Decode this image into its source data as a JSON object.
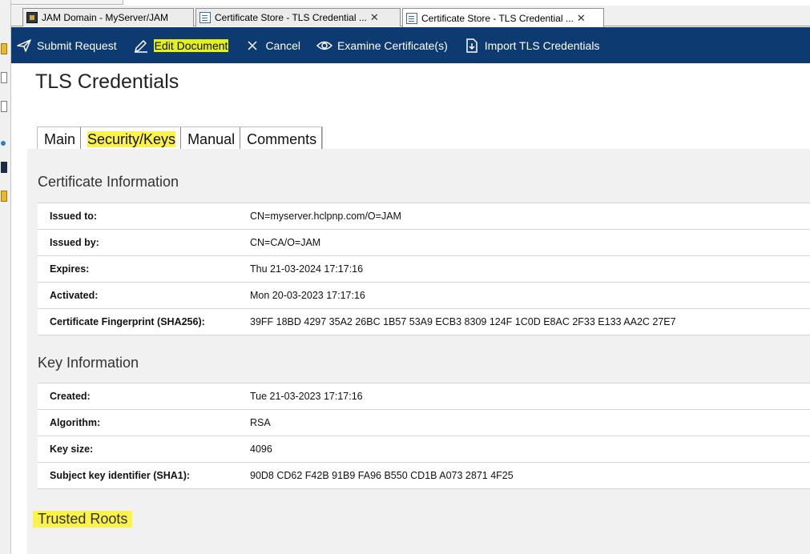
{
  "tabs": [
    {
      "label": "JAM Domain - MyServer/JAM",
      "icon": "domain-icon",
      "active": false,
      "closable": false
    },
    {
      "label": "Certificate Store - TLS Credential ...",
      "icon": "document-icon",
      "active": false,
      "closable": true
    },
    {
      "label": "Certificate Store - TLS Credential ...",
      "icon": "document-icon",
      "active": true,
      "closable": true
    }
  ],
  "tab_close_glyph": "✕",
  "actions": {
    "submit": "Submit Request",
    "edit": "Edit Document",
    "cancel": "Cancel",
    "examine": "Examine Certificate(s)",
    "import": "Import TLS Credentials"
  },
  "page_title": "TLS Credentials",
  "form_tabs": [
    "Main",
    "Security/Keys",
    "Manual",
    "Comments"
  ],
  "certificate_section": {
    "title": "Certificate Information",
    "rows": [
      {
        "label": "Issued to:",
        "value": "CN=myserver.hclpnp.com/O=JAM"
      },
      {
        "label": "Issued by:",
        "value": "CN=CA/O=JAM"
      },
      {
        "label": "Expires:",
        "value": "Thu 21-03-2024 17:17:16"
      },
      {
        "label": "Activated:",
        "value": "Mon 20-03-2023 17:17:16"
      },
      {
        "label": "Certificate Fingerprint (SHA256):",
        "value": "39FF 18BD 4297 35A2 26BC 1B57 53A9 ECB3 8309 124F 1C0D E8AC 2F33 E133 AA2C 27E7"
      }
    ]
  },
  "key_section": {
    "title": "Key Information",
    "rows": [
      {
        "label": "Created:",
        "value": "Tue 21-03-2023 17:17:16"
      },
      {
        "label": "Algorithm:",
        "value": "RSA"
      },
      {
        "label": "Key size:",
        "value": "4096"
      },
      {
        "label": "Subject key identifier (SHA1):",
        "value": "90D8 CD62 F42B 91B9 FA96 B550 CD1B A073 2871 4F25"
      }
    ]
  },
  "trusted_roots_title": "Trusted Roots",
  "colors": {
    "action_bar": "#0d3a70",
    "highlight_yellow": "#fbf24a",
    "highlight_lime": "#e4f21a",
    "content_bg": "#f1f1f1"
  }
}
